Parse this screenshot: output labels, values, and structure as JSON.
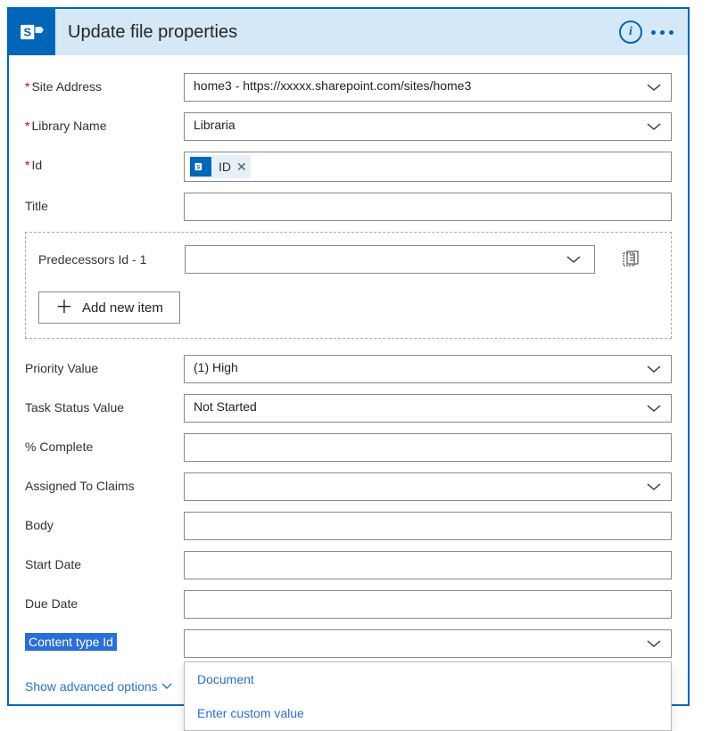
{
  "header": {
    "title": "Update file properties"
  },
  "fields": {
    "siteAddress": {
      "label": "Site Address",
      "value": "home3 - https://xxxxx.sharepoint.com/sites/home3"
    },
    "libraryName": {
      "label": "Library Name",
      "value": "Libraria"
    },
    "id": {
      "label": "Id",
      "tokenLabel": "ID"
    },
    "title": {
      "label": "Title",
      "value": ""
    },
    "predecessors": {
      "label": "Predecessors Id - 1"
    },
    "addNew": {
      "label": "Add new item"
    },
    "priority": {
      "label": "Priority Value",
      "value": "(1) High"
    },
    "taskStatus": {
      "label": "Task Status Value",
      "value": "Not Started"
    },
    "percentComplete": {
      "label": "% Complete",
      "value": ""
    },
    "assignedTo": {
      "label": "Assigned To Claims",
      "value": ""
    },
    "body": {
      "label": "Body",
      "value": ""
    },
    "startDate": {
      "label": "Start Date",
      "value": ""
    },
    "dueDate": {
      "label": "Due Date",
      "value": ""
    },
    "contentType": {
      "label": "Content type Id",
      "value": ""
    },
    "advanced": {
      "label": "Show advanced options"
    },
    "dropdown": {
      "opt1": "Document",
      "opt2": "Enter custom value"
    }
  }
}
